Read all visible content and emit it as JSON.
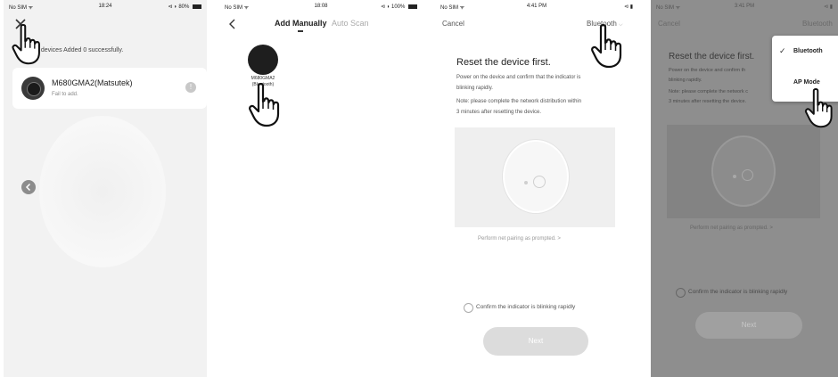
{
  "screen1": {
    "status": {
      "carrier": "No SIM ᯤ",
      "time": "18:24",
      "battery": "⊲ ◗ 80% "
    },
    "close_icon": "close-icon",
    "summary": "1 devices  Added 0 successfully.",
    "device_name": "M680GMA2(Matsutek)",
    "device_status": "Fail to add.",
    "info_icon": "info-icon",
    "back_icon": "chevron-left-icon"
  },
  "screen2": {
    "status": {
      "carrier": "No SIM ᯤ",
      "time": "18:08",
      "battery": "⊲ ◗ 100% "
    },
    "tabs": [
      {
        "label": "Add Manually"
      },
      {
        "label": "Auto Scan"
      }
    ],
    "device_label_line1": "M680GMA2",
    "device_label_line2": "(Bluetooth)"
  },
  "screen3": {
    "status": {
      "carrier": "No SIM ᯤ",
      "time": "4:41 PM",
      "battery": "⊲ ▮"
    },
    "cancel_label": "Cancel",
    "mode_label": "Bluetooth",
    "title": "Reset the device first.",
    "desc_line1": "Power on the device and confirm that the indicator is",
    "desc_line2": "blinking rapidly.",
    "note_line1": "Note: please complete the network distribution within",
    "note_line2": "3 minutes after resetting the device.",
    "help_link": "Perform net pairing as prompted. >",
    "confirm_label": "Confirm the indicator is blinking rapidly",
    "next_label": "Next"
  },
  "screen4": {
    "status": {
      "carrier": "No SIM ᯤ",
      "time": "3:41 PM",
      "battery": "⊲ ▮"
    },
    "cancel_label": "Cancel",
    "mode_label": "Bluetooth",
    "title": "Reset the device first.",
    "desc_line1": "Power on the device and confirm th",
    "desc_line2": "blinking rapidly.",
    "note_line1": "Note: please complete the network c",
    "note_line2": "3 minutes after resetting the device.",
    "help_link": "Perform net pairing as prompted. >",
    "confirm_label": "Confirm the indicator is blinking rapidly",
    "next_label": "Next",
    "menu_items": [
      {
        "label": "Bluetooth",
        "checked": true
      },
      {
        "label": "AP Mode",
        "checked": false
      }
    ]
  }
}
